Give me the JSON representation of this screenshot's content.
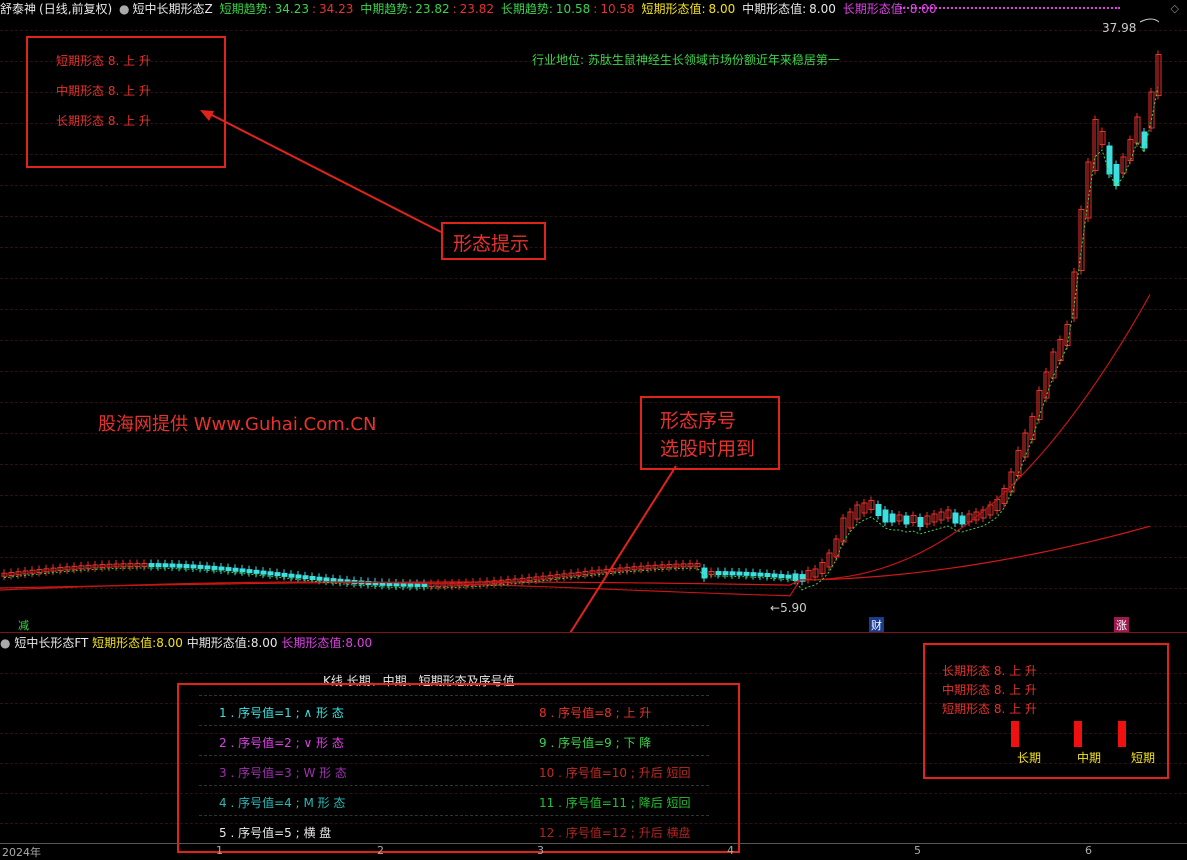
{
  "main_header": {
    "stock_name": "舒泰神",
    "period": "(日线,前复权)",
    "indicator_name": "短中长期形态Z",
    "items": [
      {
        "label": "短期趋势:",
        "value": "34.23",
        "sep": ":",
        "value2": "34.23"
      },
      {
        "label": "中期趋势:",
        "value": "23.82",
        "sep": ":",
        "value2": "23.82"
      },
      {
        "label": "长期趋势:",
        "value": "10.58",
        "sep": ":",
        "value2": "10.58"
      },
      {
        "label": "短期形态值:",
        "value": "8.00"
      },
      {
        "label": "中期形态值:",
        "value": "8.00"
      },
      {
        "label": "长期形态值:",
        "value": "8.00"
      }
    ]
  },
  "form_tips_box": {
    "lines": [
      "短期形态  8. 上 升",
      "中期形态  8. 上 升",
      "长期形态  8. 上 升"
    ]
  },
  "industry_note": "行业地位: 苏肽生鼠神经生长领域市场份额近年来稳居第一",
  "callout_form_tip": "形态提示",
  "callout_seq": [
    "形态序号",
    "选股时用到"
  ],
  "watermark": "股海网提供 Www.Guhai.Com.CN",
  "price_high": "37.98",
  "price_low": "5.90",
  "markers": {
    "left": "减",
    "middle": "财",
    "right": "涨"
  },
  "sub_header": {
    "indicator_name": "短中长形态FT",
    "items": [
      {
        "label": "短期形态值:",
        "value": "8.00"
      },
      {
        "label": "中期形态值:",
        "value": "8.00"
      },
      {
        "label": "长期形态值:",
        "value": "8.00"
      }
    ]
  },
  "table_title": "K线 长期、中期、短期形态及序号值",
  "seq_left": [
    "1 . 序号值=1  ;  ∧ 形 态",
    "2 . 序号值=2  ;  ∨ 形 态",
    "3 . 序号值=3  ;  W 形 态",
    "4 . 序号值=4  ;  M 形 态",
    "5 . 序号值=5  ;  横 盘"
  ],
  "seq_right": [
    "8 . 序号值=8  ;  上 升",
    "9 . 序号值=9  ;  下 降",
    "10 . 序号值=10  ;  升后 短回",
    "11 . 序号值=11  ;  降后 短回",
    "12 . 序号值=12  ;  升后 横盘"
  ],
  "right_box": {
    "lines": [
      "长期形态  8. 上 升",
      "中期形态  8. 上 升",
      "短期形态  8. 上 升"
    ],
    "bars": [
      "长期",
      "中期",
      "短期"
    ]
  },
  "x_axis": [
    "2024年",
    "1",
    "2",
    "3",
    "4",
    "5",
    "6"
  ],
  "colors": {
    "up": "#e8322c",
    "down": "#3ce0e0",
    "background": "#000000"
  }
}
